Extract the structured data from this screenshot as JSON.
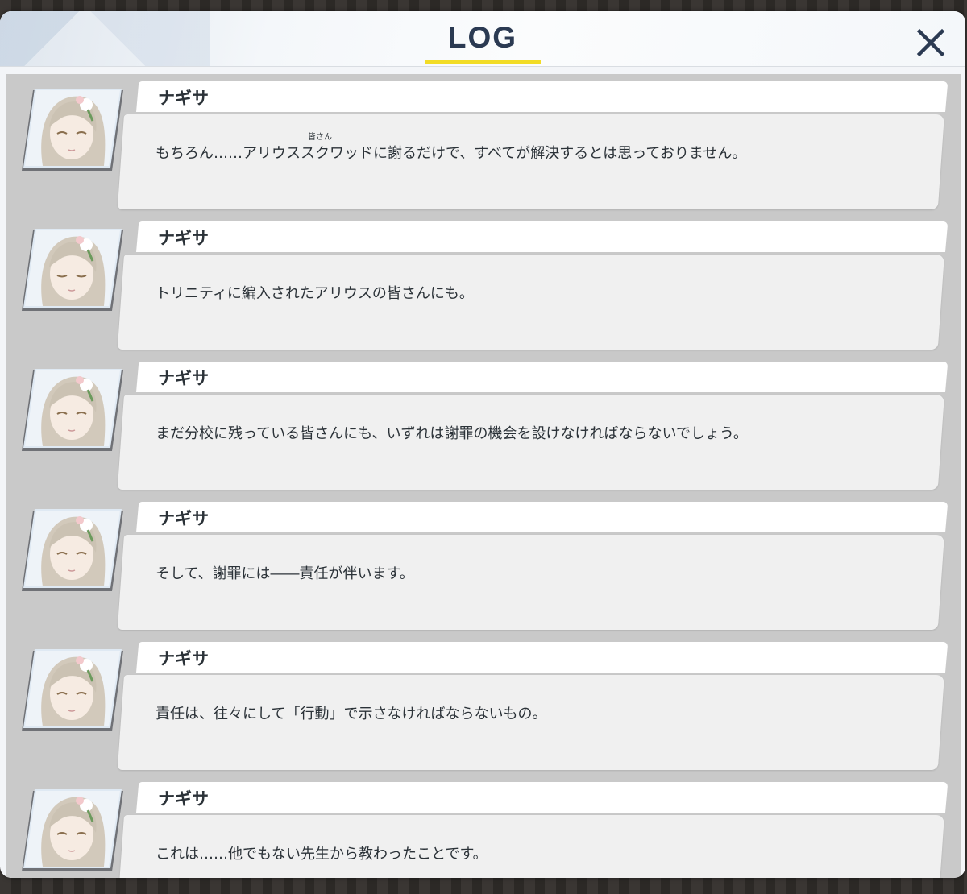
{
  "window": {
    "title": "LOG",
    "close_icon": "close-icon",
    "accent_color": "#f2dc26",
    "title_color": "#2b3a52"
  },
  "log": {
    "entries": [
      {
        "speaker": "ナギサ",
        "text": "もちろん……アリウススクワッドに謝るだけで、すべてが解決するとは思っておりません。",
        "ruby": "皆さん"
      },
      {
        "speaker": "ナギサ",
        "text": "トリニティに編入されたアリウスの皆さんにも。"
      },
      {
        "speaker": "ナギサ",
        "text": "まだ分校に残っている皆さんにも、いずれは謝罪の機会を設けなければならないでしょう。"
      },
      {
        "speaker": "ナギサ",
        "text": "そして、謝罪には――責任が伴います。"
      },
      {
        "speaker": "ナギサ",
        "text": "責任は、往々にして「行動」で示さなければならないもの。"
      },
      {
        "speaker": "ナギサ",
        "text": "これは……他でもない先生から教わったことです。"
      }
    ]
  }
}
